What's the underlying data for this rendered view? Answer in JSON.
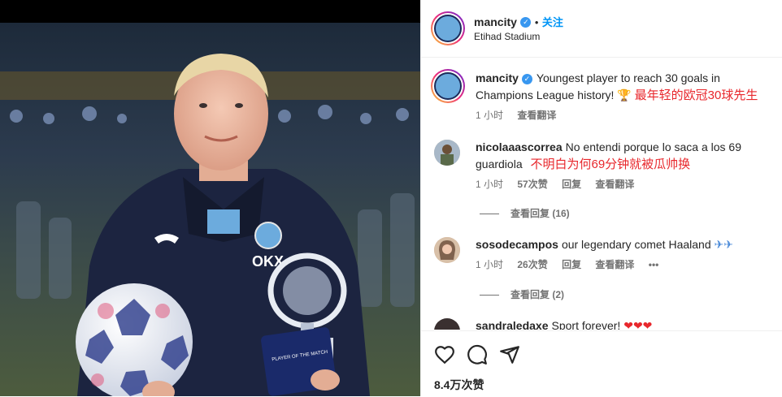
{
  "post": {
    "username": "mancity",
    "follow_label": "关注",
    "separator": "•",
    "location": "Etihad Stadium",
    "caption": "Youngest player to reach 30 goals in Champions League history! 🏆",
    "caption_overlay_cn": "最年轻的欧冠30球先生",
    "time": "1 小时",
    "translate_label": "查看翻译",
    "likes": "8.4万次赞"
  },
  "comments": [
    {
      "username": "nicolaaascorrea",
      "text": "No entendi porque lo saca a los 69 guardiola",
      "overlay_cn": "不明白为何69分钟就被瓜帅换",
      "time": "1 小时",
      "likes": "57次赞",
      "reply_label": "回复",
      "translate_label": "查看翻译",
      "view_replies": "查看回复 (16)"
    },
    {
      "username": "sosodecampos",
      "text": "our legendary comet Haaland",
      "time": "1 小时",
      "likes": "26次赞",
      "reply_label": "回复",
      "translate_label": "查看翻译",
      "more": "•••",
      "view_replies": "查看回复 (2)"
    },
    {
      "username": "sandraledaxe",
      "text": "Sport forever!"
    }
  ],
  "photo": {
    "trophy_text": "PLAYER OF THE MATCH",
    "sponsor": "OKX"
  },
  "colors": {
    "accent_blue": "#0095f6",
    "verified_blue": "#3897f0",
    "overlay_red": "#e8272c",
    "jacket_navy": "#1c2440"
  },
  "icons": [
    "heart-icon",
    "comment-icon",
    "share-icon",
    "verified-icon",
    "trophy-icon"
  ]
}
